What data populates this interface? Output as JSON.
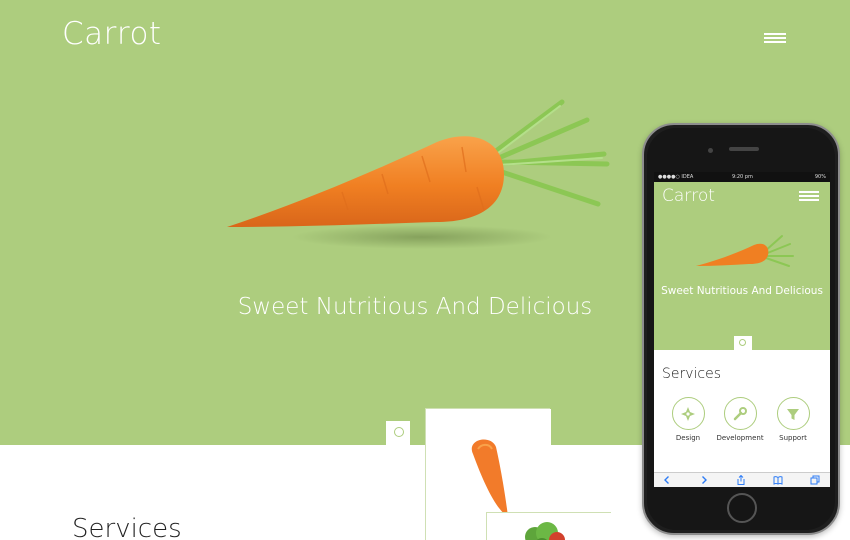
{
  "header": {
    "logo": "Carrot",
    "menu_icon": "hamburger-icon"
  },
  "hero": {
    "tagline": "Sweet Nutritious And Delicious",
    "background": "#adcd7e",
    "scroll_icon": "chevron-down-icon"
  },
  "services": {
    "heading": "Services"
  },
  "phone": {
    "status": {
      "carrier": "●●●●○ IDEA",
      "time": "9:20 pm",
      "battery": "90%"
    },
    "logo": "Carrot",
    "tagline": "Sweet Nutritious And Delicious",
    "services_heading": "Services",
    "services": [
      {
        "label": "Design",
        "icon": "compass-icon"
      },
      {
        "label": "Development",
        "icon": "wrench-icon"
      },
      {
        "label": "Support",
        "icon": "funnel-icon"
      }
    ],
    "safari_toolbar": [
      "back-icon",
      "forward-icon",
      "share-icon",
      "bookmarks-icon",
      "tabs-icon"
    ]
  },
  "colors": {
    "accent": "#adcd7e",
    "carrot": "#f58a2c",
    "leaf": "#7dc24a",
    "text_dark": "#222222"
  }
}
